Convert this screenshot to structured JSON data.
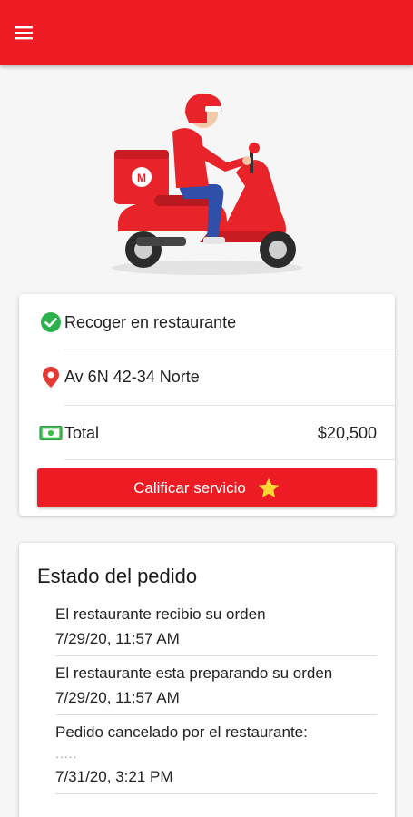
{
  "appbar": {
    "menu_icon": "hamburger-menu-icon",
    "color": "#ed1c24"
  },
  "hero": {
    "illustration": "delivery-scooter-illustration",
    "box_logo": "M"
  },
  "order": {
    "pickup": {
      "icon": "check-circle-icon",
      "label": "Recoger en restaurante"
    },
    "address": {
      "icon": "location-pin-icon",
      "label": "Av 6N 42-34 Norte"
    },
    "total": {
      "icon": "money-icon",
      "label": "Total",
      "amount": "$20,500"
    },
    "rate_button": {
      "label": "Calificar servicio",
      "icon": "star-icon"
    }
  },
  "status": {
    "title": "Estado del pedido",
    "steps": [
      {
        "text": "El restaurante recibio su orden",
        "date": "7/29/20, 11:57 AM"
      },
      {
        "text": "El restaurante esta preparando su orden",
        "date": "7/29/20, 11:57 AM"
      },
      {
        "text": "Pedido cancelado por el restaurante:",
        "note": ".....",
        "date": "7/31/20, 3:21 PM"
      }
    ]
  }
}
